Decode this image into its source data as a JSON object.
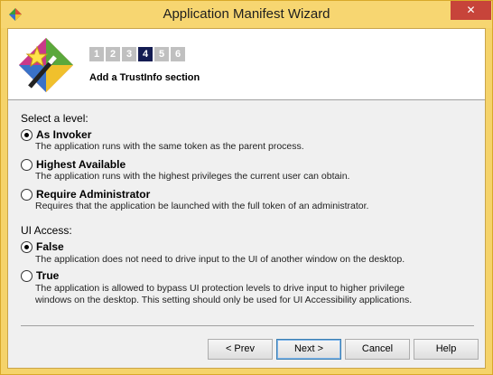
{
  "window": {
    "title": "Application Manifest Wizard",
    "close_glyph": "✕"
  },
  "header": {
    "steps": [
      "1",
      "2",
      "3",
      "4",
      "5",
      "6"
    ],
    "active_step": "4",
    "title": "Add a TrustInfo section"
  },
  "level": {
    "heading": "Select a level:",
    "options": [
      {
        "label": "As Invoker",
        "description": "The application runs with the same token as the parent process.",
        "checked": true
      },
      {
        "label": "Highest Available",
        "description": "The application runs with the highest privileges the current user can obtain.",
        "checked": false
      },
      {
        "label": "Require Administrator",
        "description": "Requires that the application be launched with the full token of an administrator.",
        "checked": false
      }
    ]
  },
  "ui_access": {
    "heading": "UI Access:",
    "options": [
      {
        "label": "False",
        "description": "The application does not need to drive input to the UI of another window on the desktop.",
        "checked": true
      },
      {
        "label": "True",
        "description_line1": "The application is allowed to bypass UI protection levels to drive input to higher privilege",
        "description_line2": "windows on the desktop. This setting should only be used for UI Accessibility applications.",
        "checked": false
      }
    ]
  },
  "buttons": {
    "prev": "< Prev",
    "next": "Next >",
    "cancel": "Cancel",
    "help": "Help"
  },
  "colors": {
    "title_bar": "#f7d671",
    "close_button": "#c7443a",
    "active_step": "#141c52",
    "inactive_step": "#c0c0c0"
  },
  "icons": {
    "app": "wizard-app-icon",
    "logo": "magic-wand-logo"
  }
}
